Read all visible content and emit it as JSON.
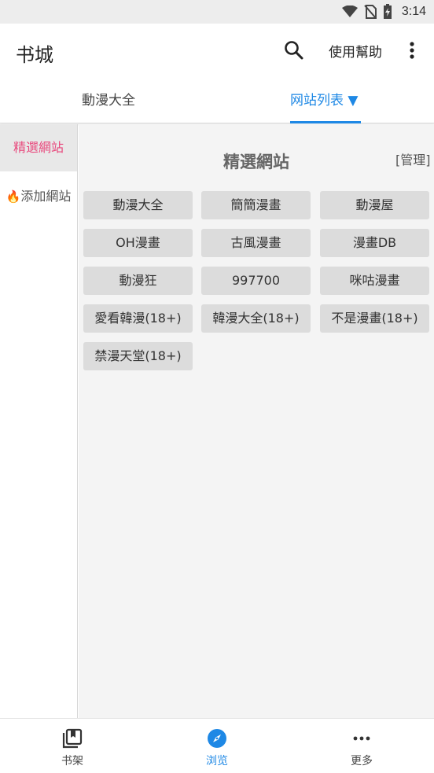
{
  "status_bar": {
    "time": "3:14"
  },
  "app_bar": {
    "title": "书城",
    "help_label": "使用幫助"
  },
  "tabs": [
    {
      "label": "動漫大全"
    },
    {
      "label": "网站列表 ▼"
    }
  ],
  "sidebar": {
    "items": [
      {
        "label": "精選網站"
      },
      {
        "label": "添加網站"
      }
    ]
  },
  "main": {
    "title": "精選網站",
    "manage_label": "[管理]",
    "sites": [
      "動漫大全",
      "簡簡漫畫",
      "動漫屋",
      "OH漫畫",
      "古風漫畫",
      "漫畫DB",
      "動漫狂",
      "997700",
      "咪咕漫畫",
      "愛看韓漫(18+)",
      "韓漫大全(18+)",
      "不是漫畫(18+)",
      "禁漫天堂(18+)"
    ]
  },
  "bottom_nav": [
    {
      "label": "书架",
      "icon": "bookshelf-icon"
    },
    {
      "label": "浏览",
      "icon": "compass-icon"
    },
    {
      "label": "更多",
      "icon": "more-dots-icon"
    }
  ],
  "colors": {
    "accent": "#1e88e5",
    "selected_side": "#e8497d"
  }
}
